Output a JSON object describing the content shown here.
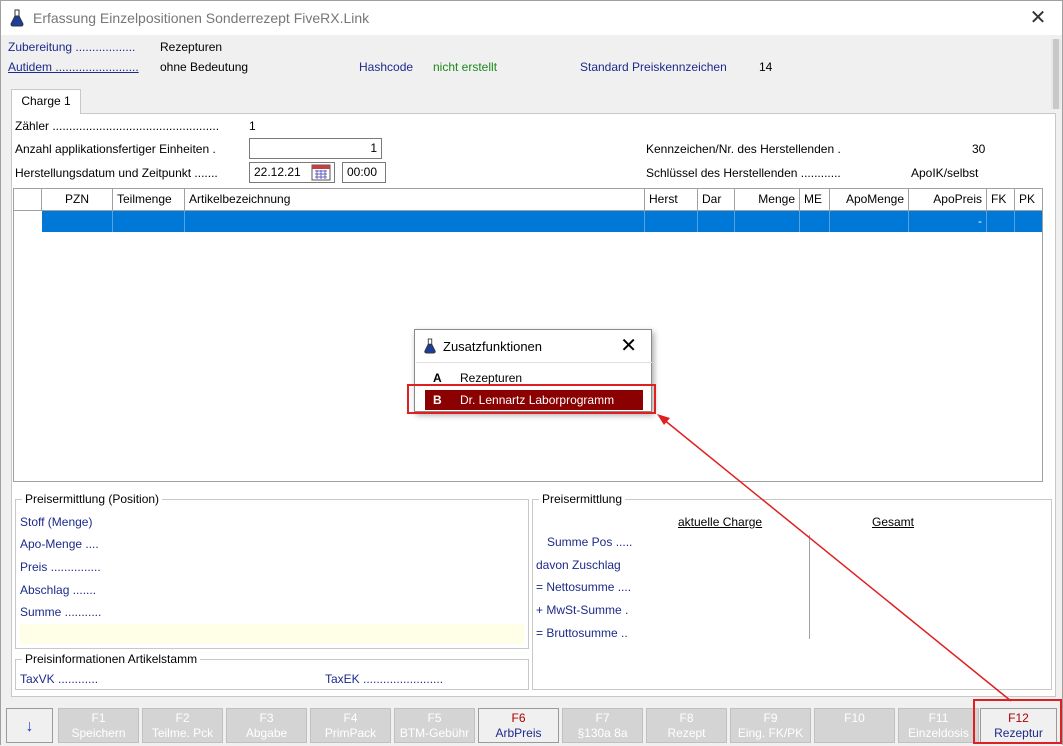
{
  "window": {
    "title": "Erfassung Einzelpositionen Sonderrezept FiveRX.Link",
    "close_glyph": "✕"
  },
  "header": {
    "zubereitung_label": "Zubereitung ..................",
    "zubereitung_value": "Rezepturen",
    "autidem_label": "Autidem .........................",
    "autidem_value": "ohne Bedeutung",
    "hashcode_label": "Hashcode",
    "hashcode_value": "nicht erstellt",
    "preiskennzeichen_label": "Standard Preiskennzeichen",
    "preiskennzeichen_value": "14"
  },
  "tabs": [
    {
      "label": "Charge 1"
    }
  ],
  "charge": {
    "zaehler_label": "Zähler ..................................................",
    "zaehler_value": "1",
    "einheiten_label": "Anzahl applikationsfertiger Einheiten .",
    "einheiten_value": "1",
    "datum_label": "Herstellungsdatum und Zeitpunkt .......",
    "datum_value": "22.12.21",
    "zeit_value": "00:00",
    "kennzeichen_label": "Kennzeichen/Nr. des Herstellenden .",
    "kennzeichen_value": "30",
    "schluessel_label": "Schlüssel des Herstellenden ............",
    "schluessel_value": "ApoIK/selbst"
  },
  "grid": {
    "columns": [
      "PZN",
      "Teilmenge",
      "Artikelbezeichnung",
      "Herst",
      "Dar",
      "Menge",
      "ME",
      "ApoMenge",
      "ApoPreis",
      "FK",
      "PK"
    ],
    "row_apopreis": "-"
  },
  "popup": {
    "title": "Zusatzfunktionen",
    "close_glyph": "✕",
    "items": [
      {
        "key": "A",
        "label": "Rezepturen"
      },
      {
        "key": "B",
        "label": "Dr. Lennartz Laborprogramm"
      }
    ]
  },
  "preis_position": {
    "title": "Preisermittlung (Position)",
    "rows": [
      "Stoff (Menge)",
      "Apo-Menge ....",
      "Preis ...............",
      "Abschlag .......",
      "Summe ..........."
    ]
  },
  "preisinfo": {
    "title": "Preisinformationen Artikelstamm",
    "taxvk": "TaxVK ............",
    "taxek": "TaxEK ........................"
  },
  "preis_gesamt": {
    "title": "Preisermittlung",
    "col_charge": "aktuelle Charge",
    "col_gesamt": "Gesamt",
    "rows": [
      "Summe Pos .....",
      "davon Zuschlag",
      "= Nettosumme ....",
      "+ MwSt-Summe .",
      "= Bruttosumme .."
    ]
  },
  "fkeys": [
    {
      "key": "F1",
      "label": "Speichern"
    },
    {
      "key": "F2",
      "label": "Teilme. Pck"
    },
    {
      "key": "F3",
      "label": "Abgabe"
    },
    {
      "key": "F4",
      "label": "PrimPack"
    },
    {
      "key": "F5",
      "label": "BTM-Gebühr"
    },
    {
      "key": "F6",
      "label": "ArbPreis"
    },
    {
      "key": "F7",
      "label": "§130a 8a"
    },
    {
      "key": "F8",
      "label": "Rezept"
    },
    {
      "key": "F9",
      "label": "Eing. FK/PK"
    },
    {
      "key": "F10",
      "label": ""
    },
    {
      "key": "F11",
      "label": "Einzeldosis"
    },
    {
      "key": "F12",
      "label": "Rezeptur"
    }
  ],
  "colors": {
    "accent_blue": "#0078d7",
    "label_blue": "#1d2a8a",
    "selection_red": "#8b0000",
    "highlight_red": "#e02020",
    "status_green": "#1a8a1a"
  }
}
